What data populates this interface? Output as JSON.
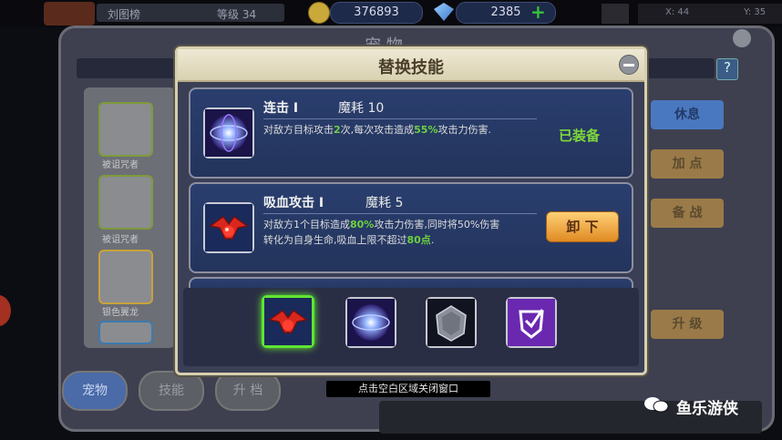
{
  "hud": {
    "player_name": "刘图榜",
    "level_label": "等级 34",
    "gold": "376893",
    "gems": "2385",
    "coord_x": "X: 44",
    "coord_y": "Y: 35"
  },
  "background": {
    "title": "宠 物",
    "help": "?",
    "pets": [
      {
        "label": "被诅咒者"
      },
      {
        "label": "被诅咒者"
      },
      {
        "label": "银色翼龙"
      }
    ],
    "side_buttons": [
      "休息",
      "加 点",
      "备 战",
      "升 级"
    ],
    "tabs": [
      "宠物",
      "技能",
      "升 档"
    ]
  },
  "modal": {
    "title": "替换技能",
    "skills": [
      {
        "name": "连击 I",
        "cost": "魔耗  10",
        "desc_parts": [
          "对敌方目标攻击",
          "2",
          "次,每次攻击造成",
          "55%",
          "攻击力伤害."
        ],
        "status": "已装备"
      },
      {
        "name": "吸血攻击 I",
        "cost": "魔耗  5",
        "desc_line1": [
          "对敌方1个目标造成",
          "80%",
          "攻击力伤害,同时将50%伤害"
        ],
        "desc_line2": [
          "转化为自身生命,吸血上限不超过",
          "80点",
          "."
        ],
        "button": "卸 下"
      }
    ],
    "slot_icons": [
      "vampire-bird-icon",
      "electric-orb-icon",
      "stone-shield-icon",
      "purple-shield-icon"
    ]
  },
  "hint": "点击空白区域关闭窗口",
  "watermark": "鱼乐游侠",
  "colors": {
    "highlight": "#6ed040",
    "button_orange": "#f0a83a",
    "card_blue": "#2a3e6e"
  }
}
